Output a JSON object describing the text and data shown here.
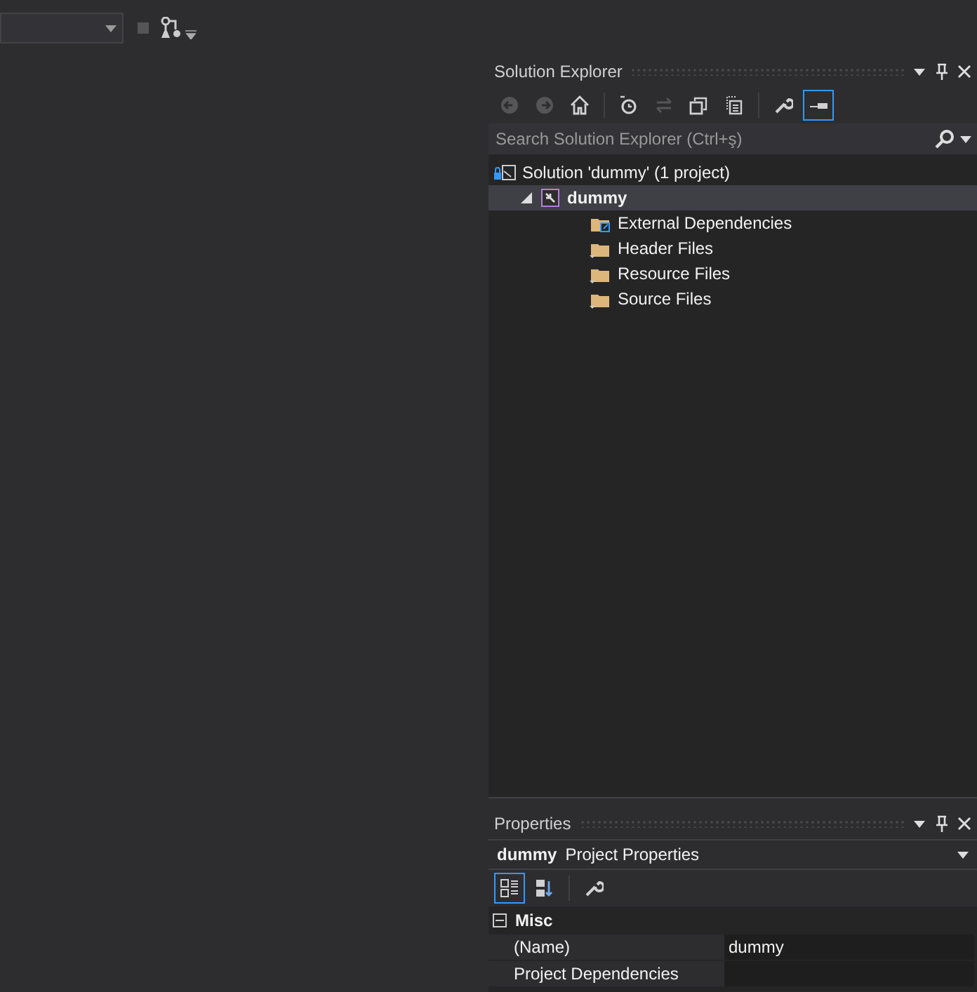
{
  "solution_explorer": {
    "title": "Solution Explorer",
    "toolbar": [
      {
        "kind": "back",
        "disabled": true,
        "active": false
      },
      {
        "kind": "forward",
        "disabled": true,
        "active": false
      },
      {
        "kind": "home",
        "disabled": false,
        "active": false
      },
      {
        "kind": "sep"
      },
      {
        "kind": "pending",
        "disabled": false,
        "active": false
      },
      {
        "kind": "sync",
        "disabled": true,
        "active": false
      },
      {
        "kind": "collapse",
        "disabled": false,
        "active": false
      },
      {
        "kind": "showall",
        "disabled": false,
        "active": false
      },
      {
        "kind": "sep"
      },
      {
        "kind": "properties",
        "disabled": false,
        "active": false
      },
      {
        "kind": "preview",
        "disabled": false,
        "active": true
      }
    ],
    "search": {
      "placeholder": "Search Solution Explorer (Ctrl+ş)"
    },
    "tree": [
      {
        "kind": "solution",
        "label": "Solution 'dummy' (1 project)",
        "selected": false,
        "children": [
          {
            "kind": "project",
            "label": "dummy",
            "selected": true,
            "expanded": true,
            "children": [
              {
                "kind": "external",
                "label": "External Dependencies",
                "selected": false
              },
              {
                "kind": "filter",
                "label": "Header Files",
                "selected": false
              },
              {
                "kind": "filter",
                "label": "Resource Files",
                "selected": false
              },
              {
                "kind": "filter",
                "label": "Source Files",
                "selected": false
              }
            ]
          }
        ]
      }
    ]
  },
  "properties": {
    "title": "Properties",
    "object": "dummy",
    "object_type": "Project Properties",
    "toolbar": [
      {
        "kind": "categorized",
        "active": true
      },
      {
        "kind": "alphabetical",
        "active": false
      },
      {
        "kind": "sep"
      },
      {
        "kind": "pages",
        "active": false
      }
    ],
    "categories": [
      {
        "label": "Misc",
        "expanded": true,
        "rows": [
          {
            "name": "(Name)",
            "value": "dummy"
          },
          {
            "name": "Project Dependencies",
            "value": ""
          }
        ]
      }
    ]
  }
}
